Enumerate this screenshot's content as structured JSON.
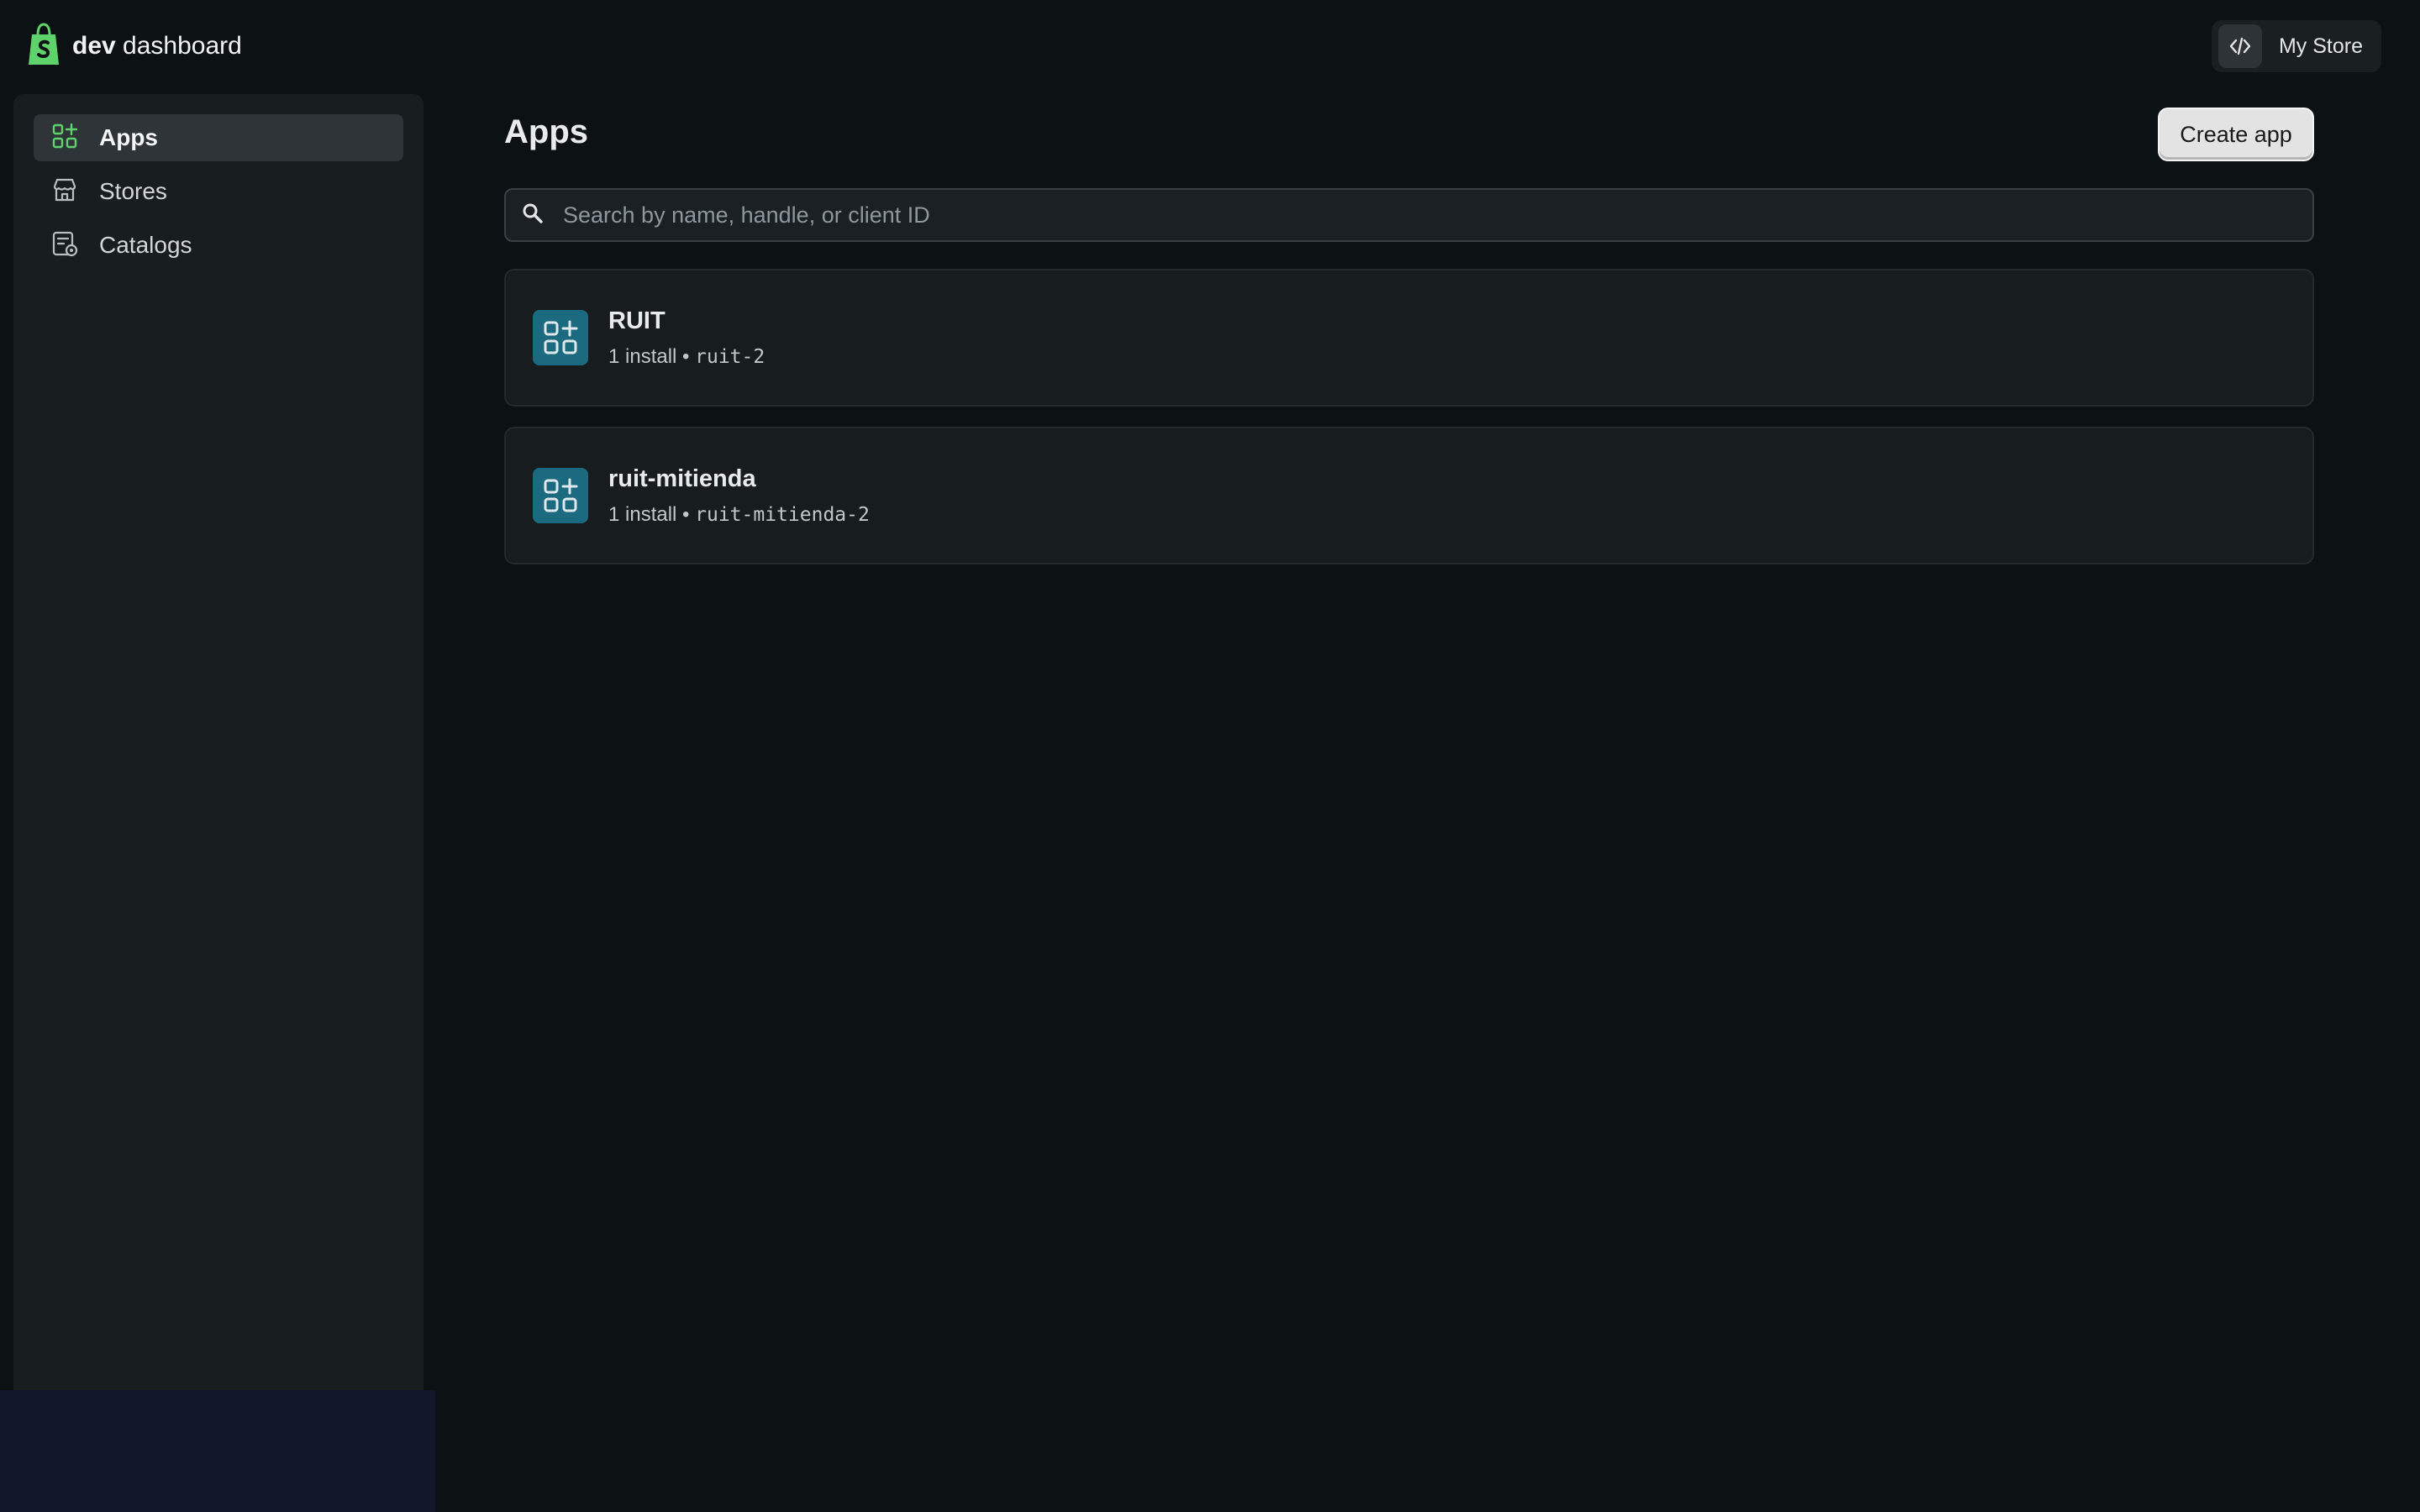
{
  "header": {
    "brand_bold": "dev",
    "brand_rest": "dashboard",
    "store_name": "My Store"
  },
  "sidebar": {
    "items": [
      {
        "label": "Apps",
        "icon": "apps-icon",
        "active": true
      },
      {
        "label": "Stores",
        "icon": "store-icon",
        "active": false
      },
      {
        "label": "Catalogs",
        "icon": "catalog-icon",
        "active": false
      }
    ]
  },
  "main": {
    "title": "Apps",
    "create_label": "Create app",
    "search_placeholder": "Search by name, handle, or client ID",
    "apps": [
      {
        "name": "RUIT",
        "installs": "1 install",
        "separator": "•",
        "handle": "ruit-2"
      },
      {
        "name": "ruit-mitienda",
        "installs": "1 install",
        "separator": "•",
        "handle": "ruit-mitienda-2"
      }
    ]
  },
  "colors": {
    "background": "#0c1213",
    "sidebar": "#181d20",
    "accent_green": "#5fd36b",
    "app_icon_bg": "#1b6a80"
  }
}
